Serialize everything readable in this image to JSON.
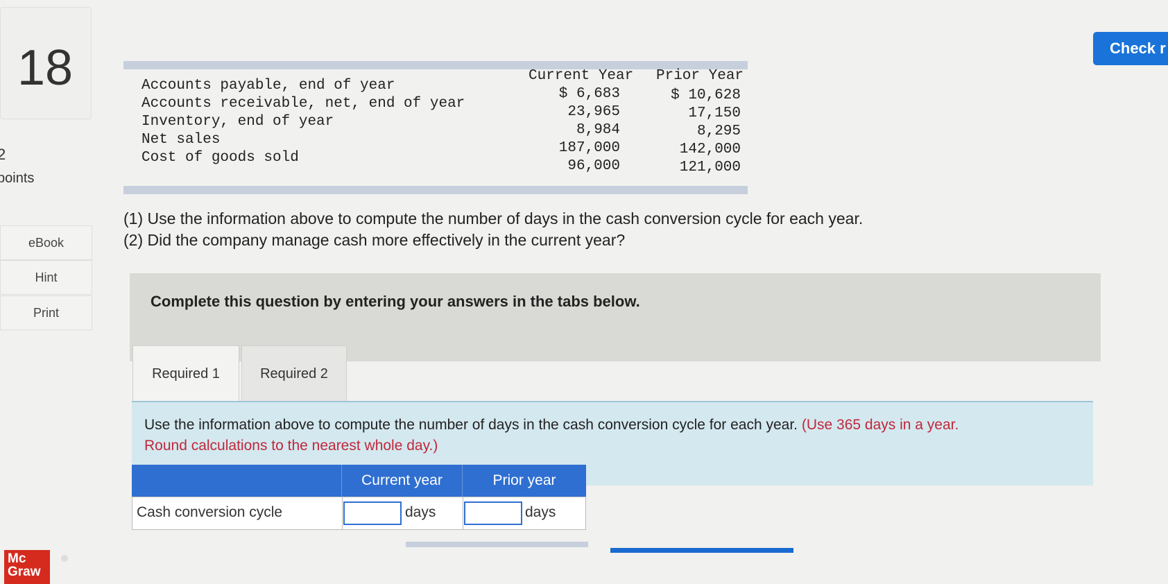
{
  "question": {
    "number": "18",
    "points_value": "2",
    "points_label": "points"
  },
  "sidebar": {
    "ebook": "eBook",
    "hint": "Hint",
    "print": "Print"
  },
  "header": {
    "check_label": "Check r"
  },
  "logo": {
    "line1": "Mc",
    "line2": "Graw"
  },
  "data_table": {
    "col_current": "Current Year",
    "col_prior": "Prior Year",
    "rows": [
      {
        "label": "Accounts payable, end of year",
        "current": "$  6,683",
        "prior": "$ 10,628"
      },
      {
        "label": "Accounts receivable, net, end of year",
        "current": "23,965",
        "prior": "17,150"
      },
      {
        "label": "Inventory, end of year",
        "current": "8,984",
        "prior": "8,295"
      },
      {
        "label": "Net sales",
        "current": "187,000",
        "prior": "142,000"
      },
      {
        "label": "Cost of goods sold",
        "current": "96,000",
        "prior": "121,000"
      }
    ]
  },
  "prompt": {
    "line1": "(1) Use the information above to compute the number of days in the cash conversion cycle for each year.",
    "line2": "(2) Did the company manage cash more effectively in the current year?"
  },
  "instructions": "Complete this question by entering your answers in the tabs below.",
  "tabs": [
    {
      "label": "Required 1"
    },
    {
      "label": "Required 2"
    }
  ],
  "answer_area": {
    "text_main": "Use the information above to compute the number of days in the cash conversion cycle for each year. ",
    "text_red_1": "(Use 365 days in a year.",
    "text_red_2": "Round calculations to the nearest whole day.)",
    "table": {
      "col_current": "Current year",
      "col_prior": "Prior year",
      "row_label": "Cash conversion cycle",
      "current_value": "",
      "prior_value": "",
      "unit": "days"
    }
  }
}
